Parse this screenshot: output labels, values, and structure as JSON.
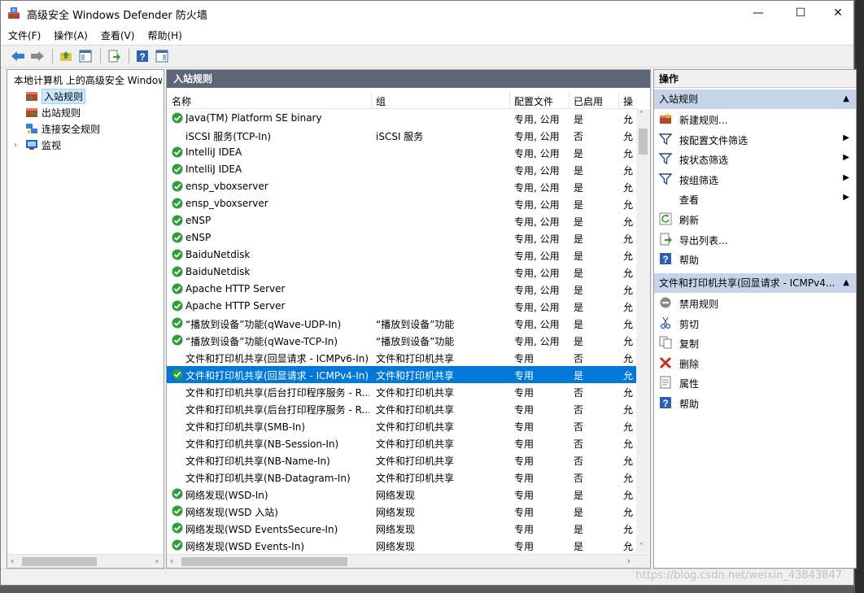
{
  "window": {
    "title": "高级安全 Windows Defender 防火墙",
    "minimize": "—",
    "maximize": "☐",
    "close": "✕"
  },
  "menu": [
    "文件(F)",
    "操作(A)",
    "查看(V)",
    "帮助(H)"
  ],
  "toolbar_icons": [
    "back-arrow-icon",
    "forward-arrow-icon",
    "up-folder-icon",
    "show-hide-tree-icon",
    "export-icon",
    "help-icon",
    "show-hide-action-icon"
  ],
  "tree": {
    "root": "本地计算机 上的高级安全 Windows",
    "items": [
      "入站规则",
      "出站规则",
      "连接安全规则",
      "监视"
    ]
  },
  "center": {
    "title": "入站规则",
    "columns": [
      "名称",
      "组",
      "配置文件",
      "已启用",
      "操"
    ],
    "rows": [
      {
        "name": "Java(TM) Platform SE binary",
        "group": "",
        "profile": "专用, 公用",
        "enabled": "是",
        "action": "允",
        "checked": true
      },
      {
        "name": "iSCSI 服务(TCP-In)",
        "group": "iSCSI 服务",
        "profile": "专用, 公用",
        "enabled": "否",
        "action": "允",
        "checked": false
      },
      {
        "name": "IntelliJ IDEA",
        "group": "",
        "profile": "专用, 公用",
        "enabled": "是",
        "action": "允",
        "checked": true
      },
      {
        "name": "IntelliJ IDEA",
        "group": "",
        "profile": "专用, 公用",
        "enabled": "是",
        "action": "允",
        "checked": true
      },
      {
        "name": "ensp_vboxserver",
        "group": "",
        "profile": "专用, 公用",
        "enabled": "是",
        "action": "允",
        "checked": true
      },
      {
        "name": "ensp_vboxserver",
        "group": "",
        "profile": "专用, 公用",
        "enabled": "是",
        "action": "允",
        "checked": true
      },
      {
        "name": "eNSP",
        "group": "",
        "profile": "专用, 公用",
        "enabled": "是",
        "action": "允",
        "checked": true
      },
      {
        "name": "eNSP",
        "group": "",
        "profile": "专用, 公用",
        "enabled": "是",
        "action": "允",
        "checked": true
      },
      {
        "name": "BaiduNetdisk",
        "group": "",
        "profile": "专用, 公用",
        "enabled": "是",
        "action": "允",
        "checked": true
      },
      {
        "name": "BaiduNetdisk",
        "group": "",
        "profile": "专用, 公用",
        "enabled": "是",
        "action": "允",
        "checked": true
      },
      {
        "name": "Apache HTTP Server",
        "group": "",
        "profile": "专用, 公用",
        "enabled": "是",
        "action": "允",
        "checked": true
      },
      {
        "name": "Apache HTTP Server",
        "group": "",
        "profile": "专用, 公用",
        "enabled": "是",
        "action": "允",
        "checked": true
      },
      {
        "name": "“播放到设备”功能(qWave-UDP-In)",
        "group": "“播放到设备”功能",
        "profile": "专用, 公用",
        "enabled": "是",
        "action": "允",
        "checked": true
      },
      {
        "name": "“播放到设备”功能(qWave-TCP-In)",
        "group": "“播放到设备”功能",
        "profile": "专用, 公用",
        "enabled": "是",
        "action": "允",
        "checked": true
      },
      {
        "name": "文件和打印机共享(回显请求 - ICMPv6-In)",
        "group": "文件和打印机共享",
        "profile": "专用",
        "enabled": "否",
        "action": "允",
        "checked": false
      },
      {
        "name": "文件和打印机共享(回显请求 - ICMPv4-In)",
        "group": "文件和打印机共享",
        "profile": "专用",
        "enabled": "是",
        "action": "允",
        "checked": true,
        "selected": true
      },
      {
        "name": "文件和打印机共享(后台打印程序服务 - R...",
        "group": "文件和打印机共享",
        "profile": "专用",
        "enabled": "否",
        "action": "允",
        "checked": false
      },
      {
        "name": "文件和打印机共享(后台打印程序服务 - R...",
        "group": "文件和打印机共享",
        "profile": "专用",
        "enabled": "否",
        "action": "允",
        "checked": false
      },
      {
        "name": "文件和打印机共享(SMB-In)",
        "group": "文件和打印机共享",
        "profile": "专用",
        "enabled": "否",
        "action": "允",
        "checked": false
      },
      {
        "name": "文件和打印机共享(NB-Session-In)",
        "group": "文件和打印机共享",
        "profile": "专用",
        "enabled": "否",
        "action": "允",
        "checked": false
      },
      {
        "name": "文件和打印机共享(NB-Name-In)",
        "group": "文件和打印机共享",
        "profile": "专用",
        "enabled": "否",
        "action": "允",
        "checked": false
      },
      {
        "name": "文件和打印机共享(NB-Datagram-In)",
        "group": "文件和打印机共享",
        "profile": "专用",
        "enabled": "否",
        "action": "允",
        "checked": false
      },
      {
        "name": "网络发现(WSD-In)",
        "group": "网络发现",
        "profile": "专用",
        "enabled": "是",
        "action": "允",
        "checked": true
      },
      {
        "name": "网络发现(WSD 入站)",
        "group": "网络发现",
        "profile": "专用",
        "enabled": "是",
        "action": "允",
        "checked": true
      },
      {
        "name": "网络发现(WSD EventsSecure-In)",
        "group": "网络发现",
        "profile": "专用",
        "enabled": "是",
        "action": "允",
        "checked": true
      },
      {
        "name": "网络发现(WSD Events-In)",
        "group": "网络发现",
        "profile": "专用",
        "enabled": "是",
        "action": "允",
        "checked": true
      }
    ]
  },
  "actions": {
    "title": "操作",
    "group1": "入站规则",
    "group1_items": [
      {
        "label": "新建规则...",
        "icon": "new-rule-icon",
        "submenu": false
      },
      {
        "label": "按配置文件筛选",
        "icon": "filter-icon",
        "submenu": true
      },
      {
        "label": "按状态筛选",
        "icon": "filter-icon",
        "submenu": true
      },
      {
        "label": "按组筛选",
        "icon": "filter-icon",
        "submenu": true
      },
      {
        "label": "查看",
        "icon": "",
        "submenu": true
      },
      {
        "label": "刷新",
        "icon": "refresh-icon",
        "submenu": false
      },
      {
        "label": "导出列表...",
        "icon": "export-list-icon",
        "submenu": false
      },
      {
        "label": "帮助",
        "icon": "help-icon",
        "submenu": false
      }
    ],
    "group2": "文件和打印机共享(回显请求 - ICMPv4...",
    "group2_items": [
      {
        "label": "禁用规则",
        "icon": "disable-rule-icon"
      },
      {
        "label": "剪切",
        "icon": "cut-icon"
      },
      {
        "label": "复制",
        "icon": "copy-icon"
      },
      {
        "label": "删除",
        "icon": "delete-icon"
      },
      {
        "label": "属性",
        "icon": "properties-icon"
      },
      {
        "label": "帮助",
        "icon": "help-icon"
      }
    ]
  },
  "watermark": "https://blog.csdn.net/weixin_43843847",
  "colors": {
    "header_bg": "#5c6677",
    "selected_row": "#0078d7",
    "action_group_bg": "#c5d4e8",
    "check_green": "#2e9d3a"
  }
}
